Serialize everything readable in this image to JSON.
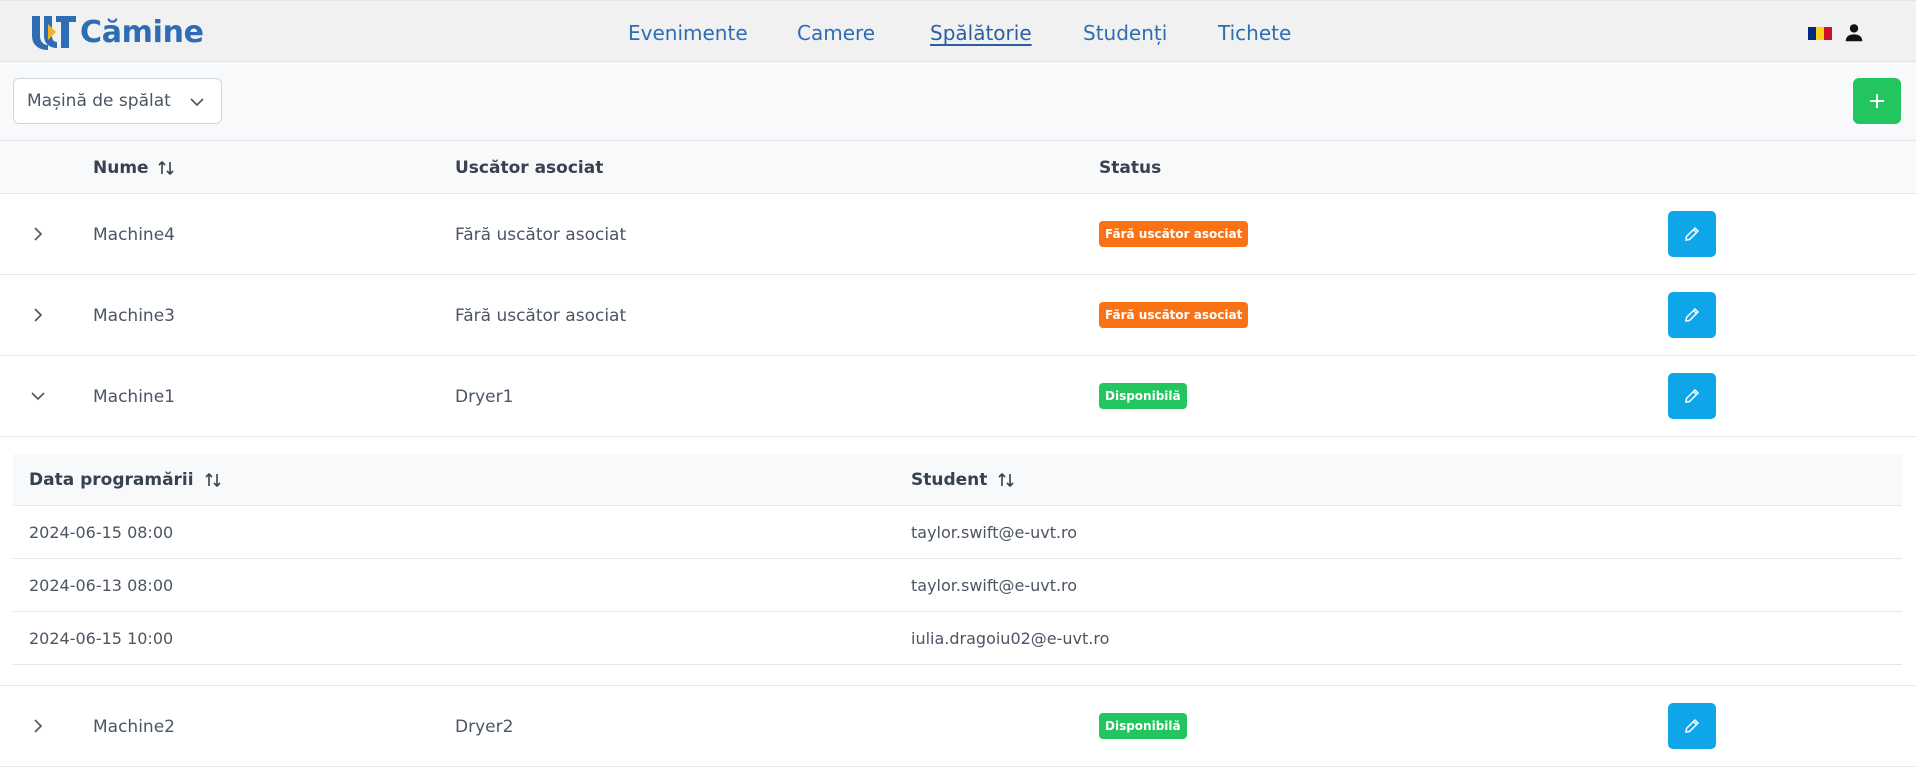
{
  "app": {
    "title": "Cămine"
  },
  "nav": {
    "items": [
      {
        "label": "Evenimente"
      },
      {
        "label": "Camere"
      },
      {
        "label": "Spălătorie"
      },
      {
        "label": "Studenți"
      },
      {
        "label": "Tichete"
      }
    ],
    "active": "Spălătorie"
  },
  "toolbar": {
    "select_value": "Mașină de spălat"
  },
  "table": {
    "headers": {
      "name": "Nume",
      "dryer": "Uscător asociat",
      "status": "Status"
    },
    "rows": [
      {
        "name": "Machine4",
        "dryer": "Fără uscător asociat",
        "status": "Fără uscător asociat",
        "status_color": "#f97316",
        "expanded": false
      },
      {
        "name": "Machine3",
        "dryer": "Fără uscător asociat",
        "status": "Fără uscător asociat",
        "status_color": "#f97316",
        "expanded": false
      },
      {
        "name": "Machine1",
        "dryer": "Dryer1",
        "status": "Disponibilă",
        "status_color": "#22c55e",
        "expanded": true
      },
      {
        "name": "Machine2",
        "dryer": "Dryer2",
        "status": "Disponibilă",
        "status_color": "#22c55e",
        "expanded": false
      }
    ]
  },
  "schedule": {
    "headers": {
      "date": "Data programării",
      "student": "Student"
    },
    "rows": [
      {
        "date": "2024-06-15 08:00",
        "student": "taylor.swift@e-uvt.ro"
      },
      {
        "date": "2024-06-13 08:00",
        "student": "taylor.swift@e-uvt.ro"
      },
      {
        "date": "2024-06-15 10:00",
        "student": "iulia.dragoiu02@e-uvt.ro"
      }
    ]
  },
  "colors": {
    "brand": "#2e6db4",
    "add": "#22c55e",
    "edit": "#0ea5e9",
    "warning": "#f97316",
    "success": "#22c55e"
  },
  "icons": {
    "logo": "uvt-logo-icon",
    "flag": "romania-flag-icon",
    "user": "user-icon",
    "sort": "sort-icon",
    "edit": "pencil-icon",
    "add": "plus-icon",
    "expand": "chevron-right-icon",
    "collapse": "chevron-down-icon"
  }
}
